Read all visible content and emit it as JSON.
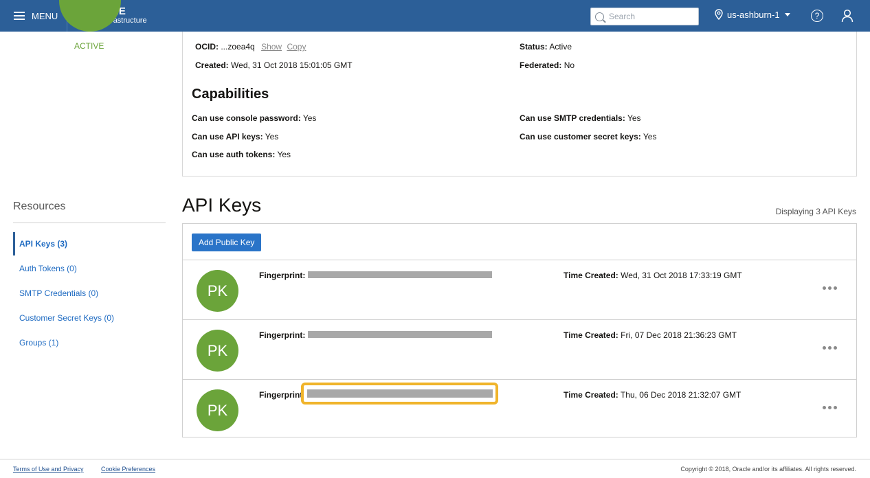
{
  "header": {
    "menu_label": "MENU",
    "brand_name": "ORACLE",
    "brand_sub": "Cloud Infrastructure",
    "search_placeholder": "Search",
    "region": "us-ashburn-1",
    "help_glyph": "?",
    "accent_color": "#2c5f98"
  },
  "user_status": "ACTIVE",
  "details": {
    "ocid_label": "OCID:",
    "ocid_value": "...zoea4q",
    "show_link": "Show",
    "copy_link": "Copy",
    "created_label": "Created:",
    "created_value": "Wed, 31 Oct 2018 15:01:05 GMT",
    "status_label": "Status:",
    "status_value": "Active",
    "federated_label": "Federated:",
    "federated_value": "No"
  },
  "capabilities": {
    "title": "Capabilities",
    "console_password_label": "Can use console password:",
    "console_password_value": "Yes",
    "api_keys_label": "Can use API keys:",
    "api_keys_value": "Yes",
    "auth_tokens_label": "Can use auth tokens:",
    "auth_tokens_value": "Yes",
    "smtp_label": "Can use SMTP credentials:",
    "smtp_value": "Yes",
    "customer_secret_label": "Can use customer secret keys:",
    "customer_secret_value": "Yes"
  },
  "resources": {
    "title": "Resources",
    "items": [
      {
        "label": "API Keys (3)"
      },
      {
        "label": "Auth Tokens (0)"
      },
      {
        "label": "SMTP Credentials (0)"
      },
      {
        "label": "Customer Secret Keys (0)"
      },
      {
        "label": "Groups (1)"
      }
    ]
  },
  "api_keys": {
    "title": "API Keys",
    "count_text": "Displaying 3 API Keys",
    "add_button": "Add Public Key",
    "fingerprint_label": "Fingerprint:",
    "time_created_label": "Time Created:",
    "rows": [
      {
        "avatar": "PK",
        "time_created": "Wed, 31 Oct 2018 17:33:19 GMT"
      },
      {
        "avatar": "PK",
        "time_created": "Fri, 07 Dec 2018 21:36:23 GMT"
      },
      {
        "avatar": "PK",
        "time_created": "Thu, 06 Dec 2018 21:32:07 GMT"
      }
    ]
  },
  "footer": {
    "terms": "Terms of Use and Privacy",
    "cookies": "Cookie Preferences",
    "copyright": "Copyright © 2018, Oracle and/or its affiliates. All rights reserved."
  }
}
